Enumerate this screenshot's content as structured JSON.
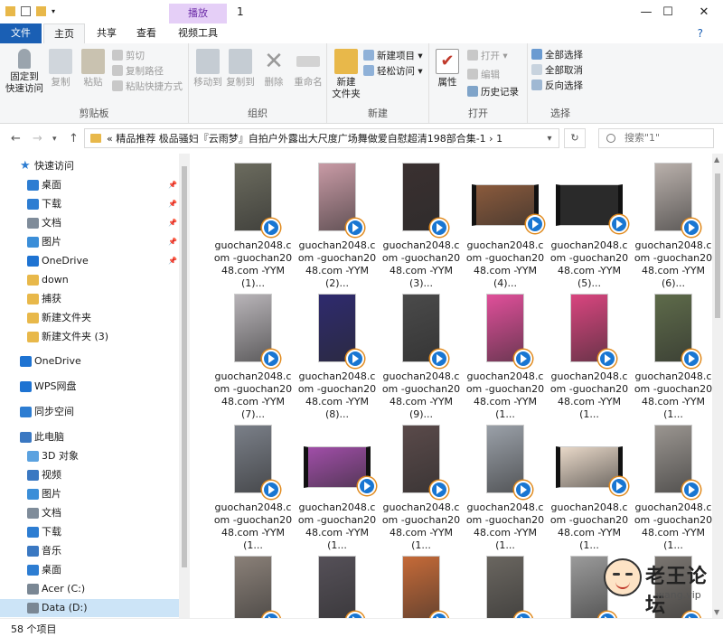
{
  "window": {
    "context_tab_label": "播放",
    "title": "1",
    "help_glyph": "?"
  },
  "menu": {
    "file": "文件",
    "home": "主页",
    "share": "共享",
    "view": "查看",
    "video_tools": "视频工具"
  },
  "ribbon": {
    "clipboard": {
      "label": "剪贴板",
      "pin": "固定到\n快速访问",
      "copy": "复制",
      "paste": "粘贴",
      "cut": "剪切",
      "copy_path": "复制路径",
      "paste_shortcut": "粘贴快捷方式"
    },
    "organize": {
      "label": "组织",
      "move_to": "移动到",
      "copy_to": "复制到",
      "delete": "删除",
      "rename": "重命名"
    },
    "new": {
      "label": "新建",
      "new_folder": "新建\n文件夹",
      "new_item": "新建项目",
      "easy_access": "轻松访问"
    },
    "open": {
      "label": "打开",
      "properties": "属性",
      "open": "打开",
      "edit": "编辑",
      "history": "历史记录"
    },
    "select": {
      "label": "选择",
      "select_all": "全部选择",
      "select_none": "全部取消",
      "invert": "反向选择"
    }
  },
  "address": {
    "path": "« 精品推荐 极品骚妇『云雨梦』自拍户外露出大尺度广场舞做爱自慰超清198部合集-1  ›  1",
    "search_placeholder": "搜索\"1\""
  },
  "nav": {
    "items": [
      {
        "label": "快速访问",
        "icon": "star",
        "pin": false,
        "indent": 0
      },
      {
        "label": "桌面",
        "icon": "desktop",
        "pin": true,
        "indent": 1
      },
      {
        "label": "下载",
        "icon": "download",
        "pin": true,
        "indent": 1
      },
      {
        "label": "文档",
        "icon": "document",
        "pin": true,
        "indent": 1
      },
      {
        "label": "图片",
        "icon": "pictures",
        "pin": true,
        "indent": 1
      },
      {
        "label": "OneDrive",
        "icon": "cloud",
        "pin": true,
        "indent": 1
      },
      {
        "label": "down",
        "icon": "folder",
        "pin": false,
        "indent": 1
      },
      {
        "label": "捕获",
        "icon": "folder",
        "pin": false,
        "indent": 1
      },
      {
        "label": "新建文件夹",
        "icon": "folder",
        "pin": false,
        "indent": 1
      },
      {
        "label": "新建文件夹 (3)",
        "icon": "folder",
        "pin": false,
        "indent": 1
      },
      {
        "label": "OneDrive",
        "icon": "cloud",
        "pin": false,
        "indent": 0
      },
      {
        "label": "WPS网盘",
        "icon": "cloud-outline",
        "pin": false,
        "indent": 0
      },
      {
        "label": "同步空间",
        "icon": "sync",
        "pin": false,
        "indent": 0
      },
      {
        "label": "此电脑",
        "icon": "pc",
        "pin": false,
        "indent": 0
      },
      {
        "label": "3D 对象",
        "icon": "3d",
        "pin": false,
        "indent": 1
      },
      {
        "label": "视频",
        "icon": "video",
        "pin": false,
        "indent": 1
      },
      {
        "label": "图片",
        "icon": "pictures",
        "pin": false,
        "indent": 1
      },
      {
        "label": "文档",
        "icon": "document",
        "pin": false,
        "indent": 1
      },
      {
        "label": "下载",
        "icon": "download",
        "pin": false,
        "indent": 1
      },
      {
        "label": "音乐",
        "icon": "music",
        "pin": false,
        "indent": 1
      },
      {
        "label": "桌面",
        "icon": "desktop",
        "pin": false,
        "indent": 1
      },
      {
        "label": "Acer (C:)",
        "icon": "drive",
        "pin": false,
        "indent": 1
      },
      {
        "label": "Data (D:)",
        "icon": "drive",
        "pin": false,
        "indent": 1
      }
    ]
  },
  "files": [
    {
      "name": "guochan2048.com -guochan2048.com -YYM (1)...",
      "color": "#6b6b5e",
      "wide": false
    },
    {
      "name": "guochan2048.com -guochan2048.com -YYM (2)...",
      "color": "#c89aa5",
      "wide": false
    },
    {
      "name": "guochan2048.com -guochan2048.com -YYM (3)...",
      "color": "#3a3030",
      "wide": false
    },
    {
      "name": "guochan2048.com -guochan2048.com -YYM (4)...",
      "color": "#8a5a3c",
      "wide": true
    },
    {
      "name": "guochan2048.com -guochan2048.com -YYM (5)...",
      "color": "#2a2a2a",
      "wide": true
    },
    {
      "name": "guochan2048.com -guochan2048.com -YYM (6)...",
      "color": "#b9b0ab",
      "wide": false
    },
    {
      "name": "guochan2048.com -guochan2048.com -YYM (7)...",
      "color": "#b8b4b8",
      "wide": false
    },
    {
      "name": "guochan2048.com -guochan2048.com -YYM (8)...",
      "color": "#2e2a6e",
      "wide": false
    },
    {
      "name": "guochan2048.com -guochan2048.com -YYM (9)...",
      "color": "#4a4a4a",
      "wide": false
    },
    {
      "name": "guochan2048.com -guochan2048.com -YYM (1...",
      "color": "#e04f9a",
      "wide": false
    },
    {
      "name": "guochan2048.com -guochan2048.com -YYM (1...",
      "color": "#d9457f",
      "wide": false
    },
    {
      "name": "guochan2048.com -guochan2048.com -YYM (1...",
      "color": "#5e6b4a",
      "wide": false
    },
    {
      "name": "guochan2048.com -guochan2048.com -YYM (1...",
      "color": "#7a7f88",
      "wide": false
    },
    {
      "name": "guochan2048.com -guochan2048.com -YYM (1...",
      "color": "#a04ea8",
      "wide": true
    },
    {
      "name": "guochan2048.com -guochan2048.com -YYM (1...",
      "color": "#5a4a4a",
      "wide": false
    },
    {
      "name": "guochan2048.com -guochan2048.com -YYM (1...",
      "color": "#9aa0a8",
      "wide": false
    },
    {
      "name": "guochan2048.com -guochan2048.com -YYM (1...",
      "color": "#e8d8c8",
      "wide": true
    },
    {
      "name": "guochan2048.com -guochan2048.com -YYM (1...",
      "color": "#9a9590",
      "wide": false
    },
    {
      "name": "",
      "color": "#8a8078",
      "wide": false
    },
    {
      "name": "",
      "color": "#555058",
      "wide": false
    },
    {
      "name": "",
      "color": "#c56a38",
      "wide": false
    },
    {
      "name": "",
      "color": "#6a6660",
      "wide": false
    },
    {
      "name": "",
      "color": "#9a9a9a",
      "wide": false
    },
    {
      "name": "",
      "color": "#7a7570",
      "wide": false
    }
  ],
  "status": {
    "count": "58 个项目"
  },
  "watermark": {
    "text": "老王论坛",
    "url": "wang.vip"
  },
  "colors": {
    "accent": "#1a5fb4",
    "context_tab": "#e5cff7",
    "selection": "#cce4f7"
  }
}
